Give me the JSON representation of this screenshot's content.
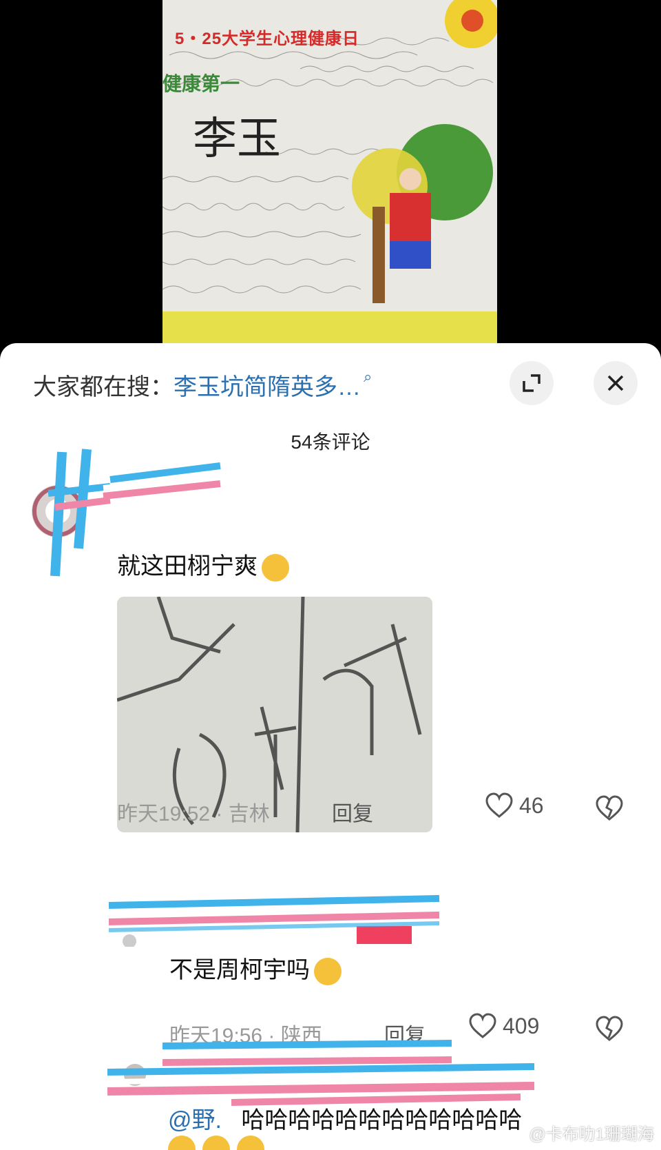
{
  "poster": {
    "title": "5・25大学生心理健康日",
    "subtitle": "健康第一",
    "name": "李玉"
  },
  "header": {
    "search_prefix": "大家都在搜：",
    "search_query": "李玉坑简隋英多…",
    "comment_count": "54条评论"
  },
  "comments": [
    {
      "text": "就这田栩宁爽",
      "time": "昨天19:52",
      "location": "吉林",
      "reply_label": "回复",
      "likes": "46"
    },
    {
      "text": "不是周柯宇吗",
      "time": "昨天19:56",
      "location": "陕西",
      "reply_label": "回复",
      "likes": "409"
    },
    {
      "mention": "@野.",
      "text": "哈哈哈哈哈哈哈哈哈哈哈哈"
    }
  ],
  "watermark": "@卡布叻1珊瑚海",
  "colors": {
    "link": "#2a6fb0",
    "panel": "#ffffff",
    "redact_blue": "#3fb3ea",
    "redact_pink": "#ef86a8"
  }
}
